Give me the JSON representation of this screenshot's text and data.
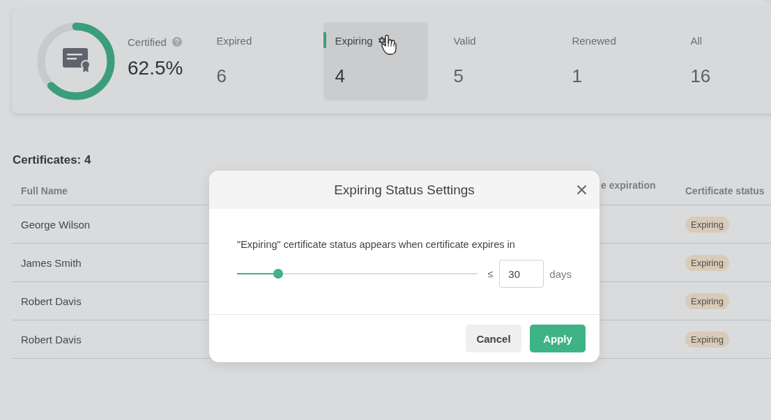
{
  "summary": {
    "certified": {
      "label": "Certified",
      "value": "62.5%"
    },
    "tabs": [
      {
        "label": "Expired",
        "count": "6",
        "selected": false
      },
      {
        "label": "Expiring",
        "count": "4",
        "selected": true
      },
      {
        "label": "Valid",
        "count": "5",
        "selected": false
      },
      {
        "label": "Renewed",
        "count": "1",
        "selected": false
      },
      {
        "label": "All",
        "count": "16",
        "selected": false
      }
    ]
  },
  "list": {
    "title": "Certificates: 4",
    "columns": [
      {
        "label": "Full Name"
      },
      {
        "label": "e expiration"
      },
      {
        "label": "Certificate status"
      }
    ],
    "rows": [
      {
        "name": "George Wilson",
        "status": "Expiring"
      },
      {
        "name": "James Smith",
        "status": "Expiring"
      },
      {
        "name": "Robert Davis",
        "status": "Expiring"
      },
      {
        "name": "Robert Davis",
        "status": "Expiring"
      }
    ]
  },
  "dialog": {
    "title": "Expiring Status Settings",
    "description": "\"Expiring\" certificate status appears when certificate expires in",
    "slider": {
      "level": 0.17
    },
    "comparator": "≤",
    "days": "30",
    "unit": "days",
    "buttons": [
      {
        "label": "Cancel",
        "kind": "secondary"
      },
      {
        "label": "Apply",
        "kind": "primary"
      }
    ]
  }
}
